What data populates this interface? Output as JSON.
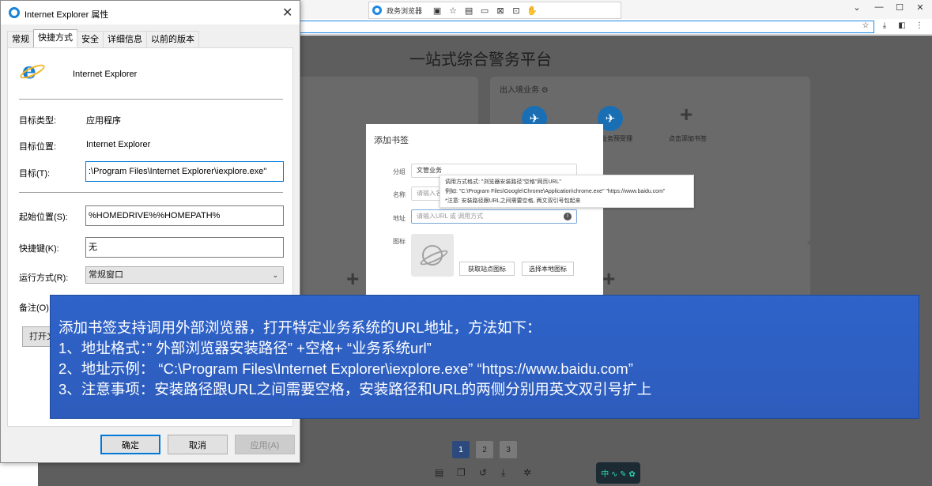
{
  "browser": {
    "name": "政务浏览器",
    "page_title": "一站式综合警务平台",
    "window_controls": [
      "⌄",
      "—",
      "☐",
      "✕"
    ],
    "tools": [
      "monitor-icon",
      "star-icon",
      "image-icon",
      "screen-icon",
      "crop-icon",
      "remote-icon",
      "hand-icon"
    ]
  },
  "card_right": {
    "title": "出入境业务",
    "apps": [
      "业务预受理",
      "点击添加书签"
    ]
  },
  "add_bookmark": {
    "title": "添加书签",
    "group_label": "分组",
    "group_value": "文管业务",
    "name_label": "名称",
    "name_placeholder": "请输入名",
    "address_label": "地址",
    "address_placeholder": "请输入URL 或 调用方式",
    "icon_label": "图标",
    "fetch_icon_button": "获取站点图标",
    "local_icon_button": "选择本地图标",
    "tooltip": [
      "调用方式格式: \"浏览器安装路径\"空格\"网页URL\"",
      "例如: \"C:\\Program Files\\Google\\Chrome\\Application\\chrome.exe\" \"https://www.baidu.com\"",
      "*注意: 安装路径跟URL之间需要空格, 两文双引号包起来"
    ]
  },
  "pagination": [
    "1",
    "2",
    "3"
  ],
  "properties_dialog": {
    "title": "Internet Explorer 属性",
    "tabs": [
      "常规",
      "快捷方式",
      "安全",
      "详细信息",
      "以前的版本"
    ],
    "active_tab": "快捷方式",
    "app_name": "Internet Explorer",
    "target_type_label": "目标类型:",
    "target_type_value": "应用程序",
    "target_location_label": "目标位置:",
    "target_location_value": "Internet Explorer",
    "target_label": "目标(T):",
    "target_value": ":\\Program Files\\Internet Explorer\\iexplore.exe\"",
    "start_in_label": "起始位置(S):",
    "start_in_value": "%HOMEDRIVE%%HOMEPATH%",
    "shortcut_key_label": "快捷键(K):",
    "shortcut_key_value": "无",
    "run_label": "运行方式(R):",
    "run_value": "常规窗口",
    "comment_label": "备注(O):",
    "open_location_button": "打开文",
    "ok_button": "确定",
    "cancel_button": "取消",
    "apply_button": "应用(A)"
  },
  "note": {
    "lines": [
      "添加书签支持调用外部浏览器，打开特定业务系统的URL地址，方法如下：",
      "1、地址格式：” 外部浏览器安装路径” +空格+ “业务系统url”",
      "2、地址示例： “C:\\Program Files\\Internet Explorer\\iexplore.exe” “https://www.baidu.com”",
      "3、注意事项：安装路径跟URL之间需要空格，安装路径和URL的两侧分别用英文双引号扩上"
    ]
  },
  "colors": {
    "note_bg": "#2f63c9",
    "accent": "#0078d7",
    "page_overlay": "#5e5e5e"
  }
}
